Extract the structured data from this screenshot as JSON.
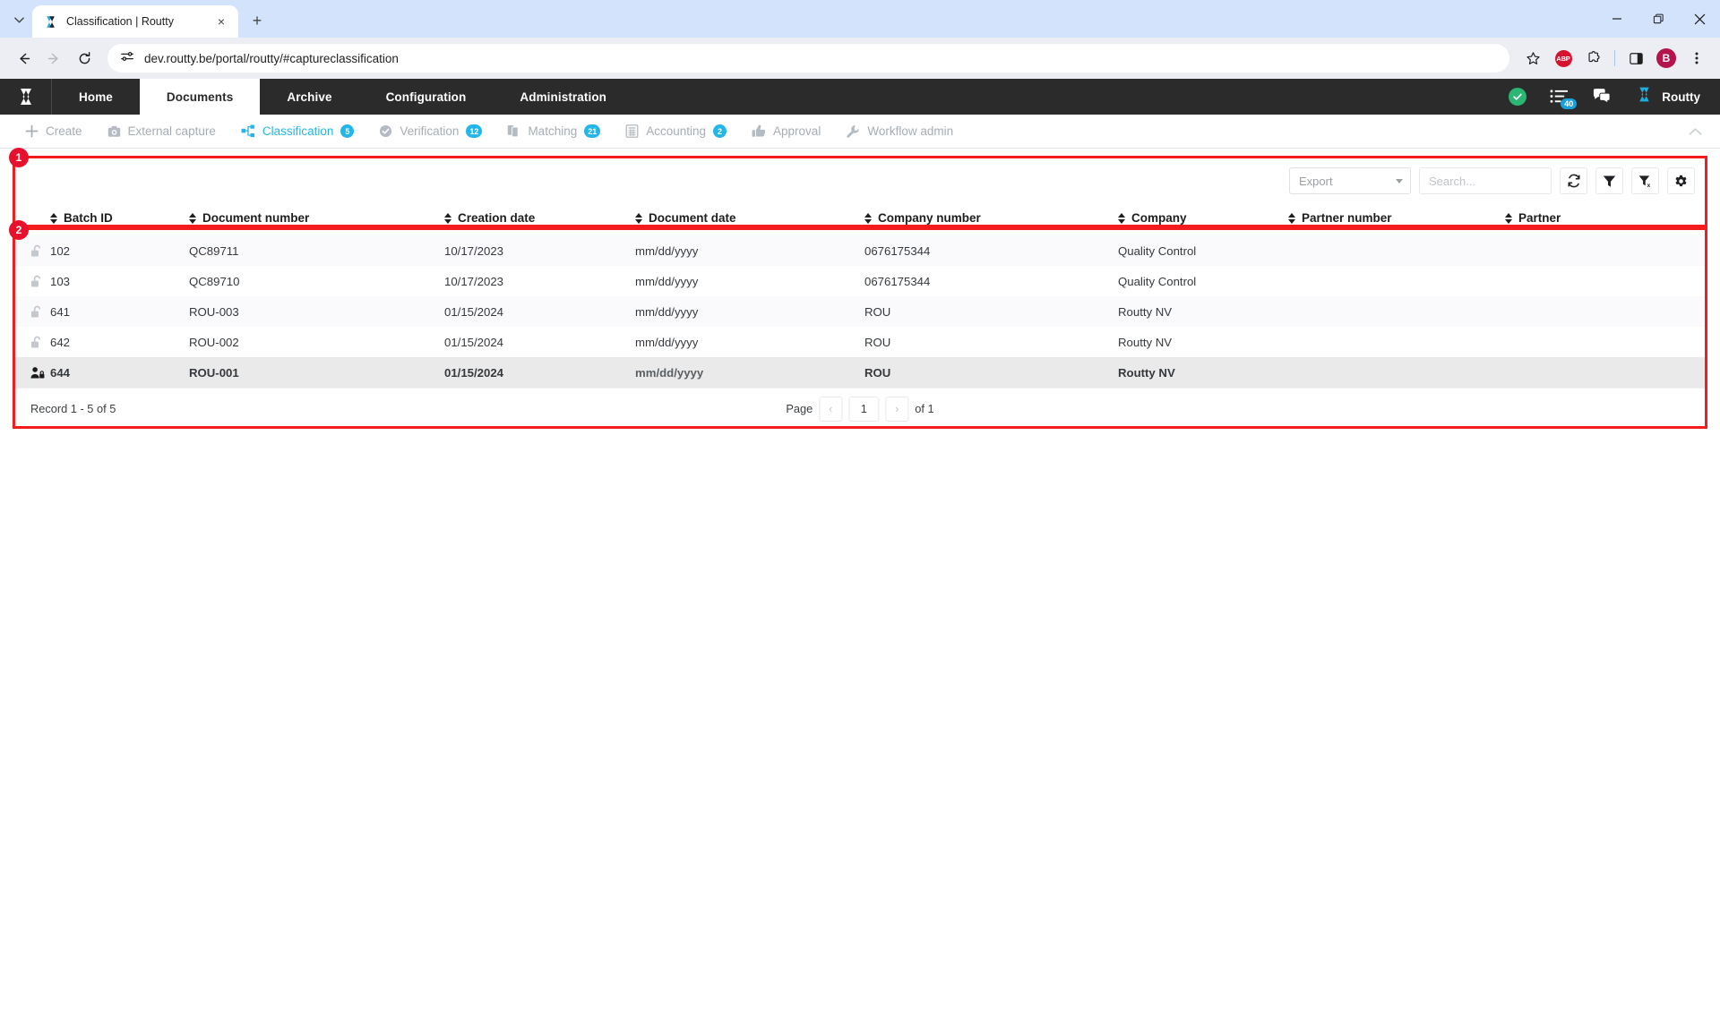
{
  "browser": {
    "tab": {
      "title": "Classification | Routty",
      "favicon": "routty-logo-icon",
      "close": "×"
    },
    "newtab_label": "+",
    "tabstrip_menu": "⌄",
    "window_controls": {
      "minimize": "—",
      "maximize": "❐",
      "close": "✕"
    },
    "nav": {
      "back": "←",
      "forward": "→",
      "reload": "⟳"
    },
    "omnibox": {
      "url": "dev.routty.be/portal/routty/#captureclassification",
      "site_info_icon": "site-settings-icon"
    },
    "toolbar_icons": [
      {
        "name": "bookmark-star-icon",
        "glyph": "☆"
      },
      {
        "name": "adblock-plus-icon",
        "glyph": "ABP"
      },
      {
        "name": "extensions-puzzle-icon",
        "glyph": "puzzle"
      },
      {
        "name": "side-panel-icon",
        "glyph": "panel"
      },
      {
        "name": "profile-avatar",
        "glyph": "B"
      },
      {
        "name": "chrome-menu-icon",
        "glyph": "⋮"
      }
    ]
  },
  "app_nav": {
    "logo": "routty-logo",
    "items": [
      {
        "label": "Home",
        "active": false
      },
      {
        "label": "Documents",
        "active": true
      },
      {
        "label": "Archive",
        "active": false
      },
      {
        "label": "Configuration",
        "active": false
      },
      {
        "label": "Administration",
        "active": false
      }
    ],
    "status_ok_icon": "✔",
    "queue_badge": "40",
    "chat_icon": "chat-bubbles-icon",
    "user": "Routty"
  },
  "sub_nav": {
    "items": [
      {
        "label": "Create",
        "icon": "plus-icon",
        "badge": null,
        "active": false
      },
      {
        "label": "External capture",
        "icon": "camera-icon",
        "badge": null,
        "active": false
      },
      {
        "label": "Classification",
        "icon": "sitemap-icon",
        "badge": "5",
        "active": true
      },
      {
        "label": "Verification",
        "icon": "check-shield-icon",
        "badge": "12",
        "active": false
      },
      {
        "label": "Matching",
        "icon": "copy-documents-icon",
        "badge": "21",
        "active": false
      },
      {
        "label": "Accounting",
        "icon": "calculator-icon",
        "badge": "2",
        "active": false
      },
      {
        "label": "Approval",
        "icon": "thumbs-up-icon",
        "badge": null,
        "active": false
      },
      {
        "label": "Workflow admin",
        "icon": "wrench-icon",
        "badge": null,
        "active": false
      }
    ],
    "collapse_icon": "chevron-up-icon"
  },
  "toolbar": {
    "export_label": "Export",
    "search_placeholder": "Search...",
    "search_value": "",
    "buttons": [
      {
        "name": "refresh-button",
        "icon": "refresh-icon"
      },
      {
        "name": "filter-button",
        "icon": "filter-icon"
      },
      {
        "name": "clear-filter-button",
        "icon": "filter-clear-icon"
      },
      {
        "name": "settings-button",
        "icon": "gear-icon"
      }
    ]
  },
  "table": {
    "columns": [
      {
        "key": "lock",
        "label": ""
      },
      {
        "key": "batch_id",
        "label": "Batch ID"
      },
      {
        "key": "document_number",
        "label": "Document number"
      },
      {
        "key": "creation_date",
        "label": "Creation date"
      },
      {
        "key": "document_date",
        "label": "Document date"
      },
      {
        "key": "company_number",
        "label": "Company number"
      },
      {
        "key": "company",
        "label": "Company"
      },
      {
        "key": "partner_number",
        "label": "Partner number"
      },
      {
        "key": "partner",
        "label": "Partner"
      }
    ],
    "rows": [
      {
        "lock_icon": "unlocked-icon",
        "locked_by_user": false,
        "selected": false,
        "batch_id": "102",
        "document_number": "QC89711",
        "creation_date": "10/17/2023",
        "document_date": "mm/dd/yyyy",
        "company_number": "0676175344",
        "company": "Quality Control",
        "partner_number": "",
        "partner": ""
      },
      {
        "lock_icon": "unlocked-icon",
        "locked_by_user": false,
        "selected": false,
        "batch_id": "103",
        "document_number": "QC89710",
        "creation_date": "10/17/2023",
        "document_date": "mm/dd/yyyy",
        "company_number": "0676175344",
        "company": "Quality Control",
        "partner_number": "",
        "partner": ""
      },
      {
        "lock_icon": "unlocked-icon",
        "locked_by_user": false,
        "selected": false,
        "batch_id": "641",
        "document_number": "ROU-003",
        "creation_date": "01/15/2024",
        "document_date": "mm/dd/yyyy",
        "company_number": "ROU",
        "company": "Routty NV",
        "partner_number": "",
        "partner": ""
      },
      {
        "lock_icon": "unlocked-icon",
        "locked_by_user": false,
        "selected": false,
        "batch_id": "642",
        "document_number": "ROU-002",
        "creation_date": "01/15/2024",
        "document_date": "mm/dd/yyyy",
        "company_number": "ROU",
        "company": "Routty NV",
        "partner_number": "",
        "partner": ""
      },
      {
        "lock_icon": "user-locked-icon",
        "locked_by_user": true,
        "selected": true,
        "batch_id": "644",
        "document_number": "ROU-001",
        "creation_date": "01/15/2024",
        "document_date": "mm/dd/yyyy",
        "company_number": "ROU",
        "company": "Routty NV",
        "partner_number": "",
        "partner": ""
      }
    ]
  },
  "footer": {
    "record_count": "Record 1 - 5 of 5",
    "page_label": "Page",
    "page_value": "1",
    "of_label": "of 1",
    "prev_arrow": "‹",
    "next_arrow": "›"
  },
  "annotations": [
    {
      "id": "1"
    },
    {
      "id": "2"
    }
  ],
  "colors": {
    "accent": "#23b6e8",
    "nav_bg": "#2b2b2b",
    "annotation_red": "#f41c1c",
    "badge_red": "#e8112d",
    "status_green": "#2bb673",
    "queue_blue": "#1b9fd8"
  }
}
